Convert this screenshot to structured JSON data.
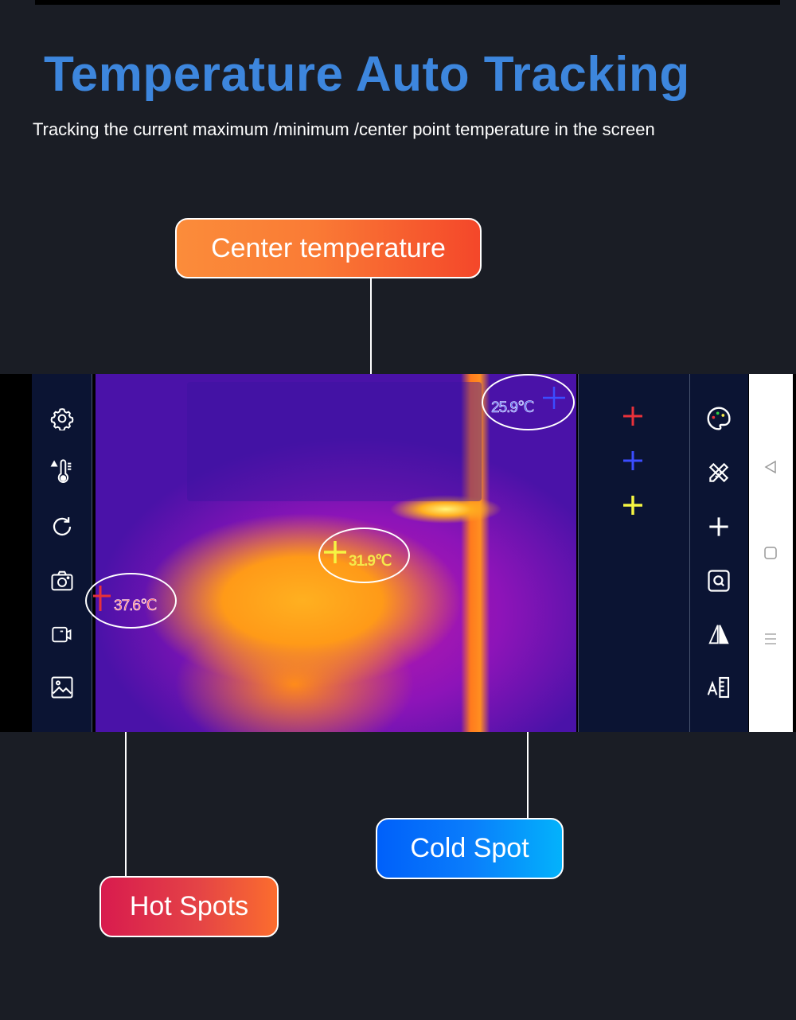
{
  "header": {
    "title": "Temperature Auto Tracking",
    "subtitle": "Tracking the current maximum /minimum /center point temperature in the screen"
  },
  "callouts": {
    "center": "Center temperature",
    "hot": "Hot Spots",
    "cold": "Cold Spot"
  },
  "readings": {
    "hot": {
      "value": "37.6℃",
      "color": "#e8313a"
    },
    "center": {
      "value": "31.9℃",
      "color": "#f5e84a"
    },
    "cold": {
      "value": "25.9℃",
      "color": "#3b4dff"
    }
  },
  "left_toolbar": [
    {
      "icon": "settings-icon"
    },
    {
      "icon": "temperature-alarm-icon"
    },
    {
      "icon": "refresh-icon"
    },
    {
      "icon": "camera-icon"
    },
    {
      "icon": "video-icon"
    },
    {
      "icon": "gallery-icon"
    }
  ],
  "marker_panel": [
    {
      "icon": "hot-marker-icon",
      "color": "#e8313a"
    },
    {
      "icon": "cold-marker-icon",
      "color": "#3b4dff"
    },
    {
      "icon": "center-marker-icon",
      "color": "#f5f542"
    }
  ],
  "right_toolbar": [
    {
      "icon": "palette-icon"
    },
    {
      "icon": "measure-tools-icon"
    },
    {
      "icon": "add-point-icon"
    },
    {
      "icon": "zoom-icon"
    },
    {
      "icon": "mirror-icon"
    },
    {
      "icon": "text-annotation-icon"
    }
  ],
  "android_nav": [
    "back-icon",
    "home-icon",
    "menu-icon"
  ]
}
